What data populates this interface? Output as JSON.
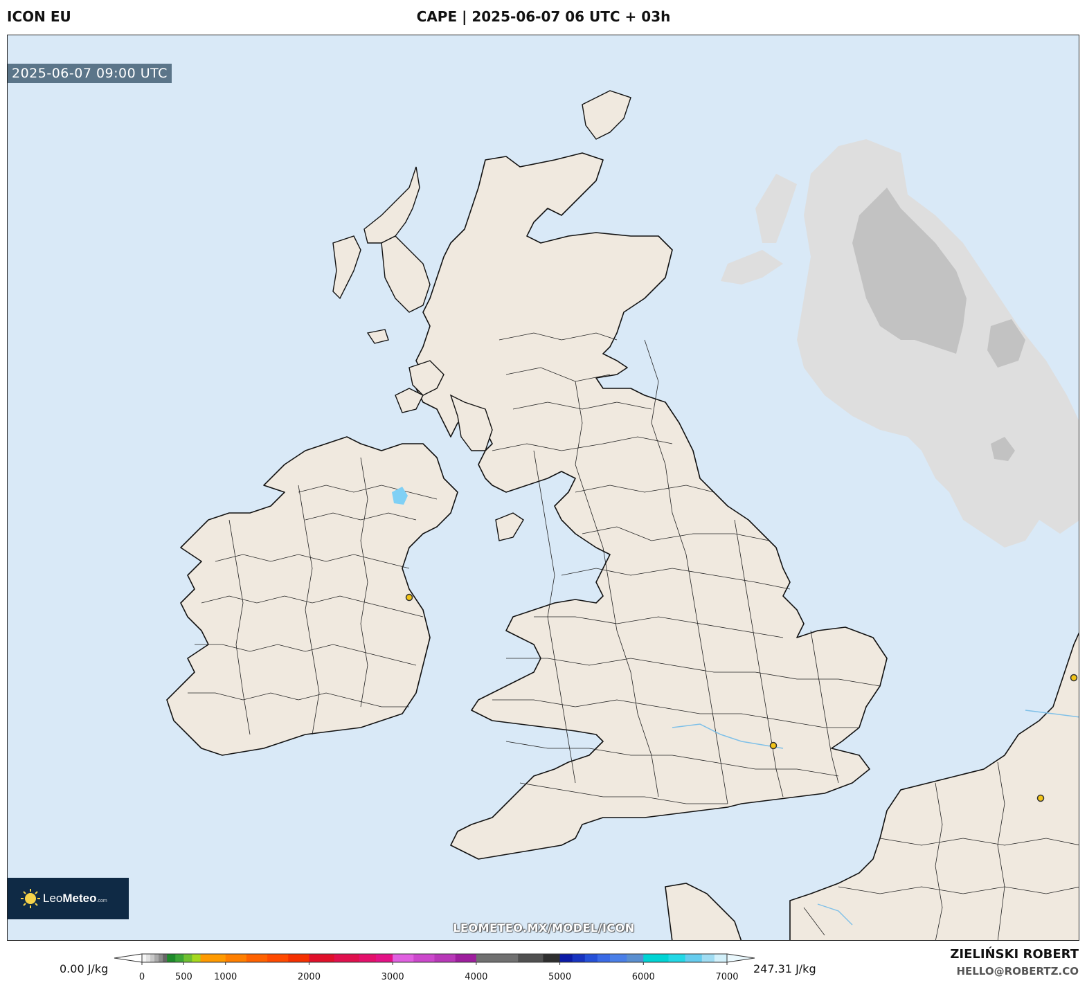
{
  "header": {
    "model": "ICON EU",
    "title": "CAPE | 2025-06-07 06 UTC + 03h"
  },
  "map": {
    "valid_time": "2025-06-07 09:00 UTC",
    "watermark": "LEOMETEO.MX/MODEL/ICON",
    "logo": {
      "brand_light": "Leo",
      "brand_bold": "Meteo",
      "brand_suffix": ".com"
    },
    "colors": {
      "sea": "#d9e9f7",
      "land": "#f0e9df",
      "cloud_light": "#dedede",
      "cloud_dark": "#c2c2c2",
      "cape_highlight": "#7fd0f5",
      "city_marker": "#f2c418"
    }
  },
  "colorbar": {
    "min_label": "0.00 J/kg",
    "max_label": "247.31 J/kg",
    "ticks": [
      "0",
      "500",
      "1000",
      "2000",
      "3000",
      "4000",
      "5000",
      "6000",
      "7000"
    ]
  },
  "footer": {
    "author": "ZIELIŃSKI ROBERT",
    "email": "HELLO@ROBERTZ.CO"
  }
}
